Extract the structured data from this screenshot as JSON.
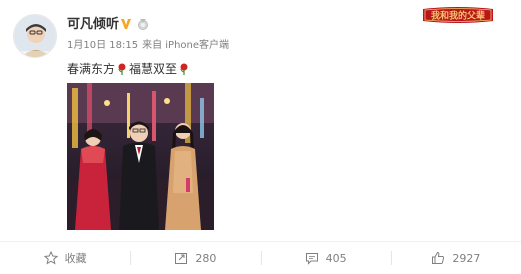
{
  "user": {
    "name": "可凡倾听",
    "post_time": "1月10日 18:15",
    "source": "来自 iPhone客户端"
  },
  "post": {
    "text_part1": "春满东方",
    "text_part2": "福慧双至"
  },
  "actions": {
    "favorite_label": "收藏",
    "repost_count": "280",
    "comment_count": "405",
    "like_count": "2927"
  },
  "banner": {
    "text": "我和我的父辈"
  },
  "colors": {
    "accent_orange": "#f5a623",
    "banner_red": "#b8161b",
    "banner_gold": "#f3c46a",
    "text_main": "#333333",
    "text_meta": "#808080"
  }
}
